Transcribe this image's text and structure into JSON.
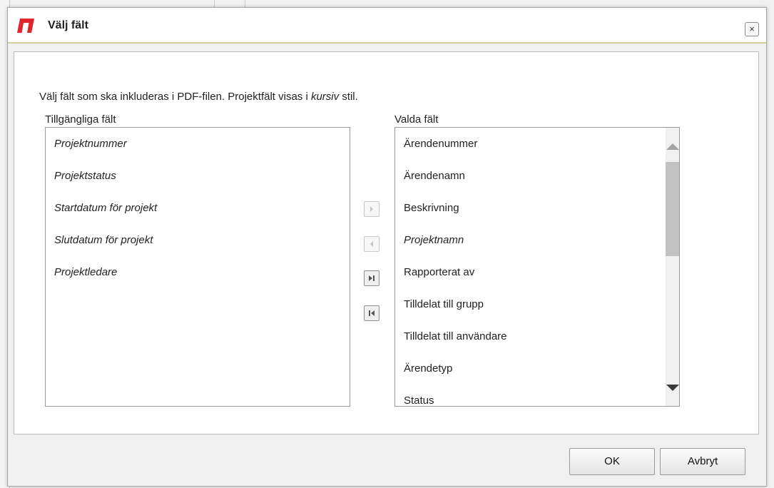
{
  "dialog": {
    "title": "Välj fält",
    "close_icon": "close-icon",
    "instruction_before": "Välj fält som ska inkluderas i PDF-filen. Projektfält visas i ",
    "instruction_emphasis": "kursiv",
    "instruction_after": " stil."
  },
  "available": {
    "label": "Tillgängliga fält",
    "items": [
      {
        "label": "Projektnummer",
        "project": true
      },
      {
        "label": "Projektstatus",
        "project": true
      },
      {
        "label": "Startdatum för projekt",
        "project": true
      },
      {
        "label": "Slutdatum för projekt",
        "project": true
      },
      {
        "label": "Projektledare",
        "project": true
      }
    ]
  },
  "selected": {
    "label": "Valda fält",
    "items": [
      {
        "label": "Ärendenummer",
        "project": false
      },
      {
        "label": "Ärendenamn",
        "project": false
      },
      {
        "label": "Beskrivning",
        "project": false
      },
      {
        "label": "Projektnamn",
        "project": true
      },
      {
        "label": "Rapporterat av",
        "project": false
      },
      {
        "label": "Tilldelat till grupp",
        "project": false
      },
      {
        "label": "Tilldelat till användare",
        "project": false
      },
      {
        "label": "Ärendetyp",
        "project": false
      },
      {
        "label": "Status",
        "project": false
      }
    ]
  },
  "buttons": {
    "ok": "OK",
    "cancel": "Avbryt"
  },
  "colors": {
    "logo_red": "#e0262c",
    "title_underline": "#d4d098"
  }
}
